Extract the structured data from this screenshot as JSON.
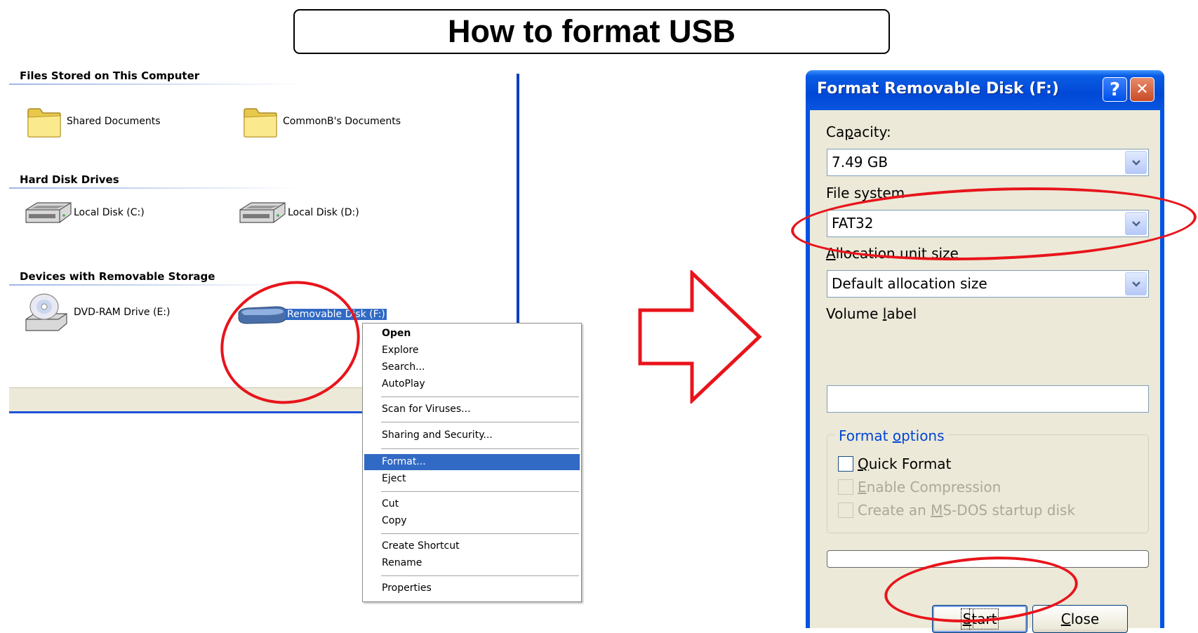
{
  "banner": {
    "title": "How to format USB"
  },
  "explorer": {
    "sections": [
      {
        "header": "Files Stored on This Computer"
      },
      {
        "header": "Hard Disk Drives"
      },
      {
        "header": "Devices with Removable Storage"
      }
    ],
    "items": [
      {
        "label": "Shared Documents",
        "icon": "folder-icon"
      },
      {
        "label": "CommonB's Documents",
        "icon": "folder-icon"
      },
      {
        "label": "Local Disk (C:)",
        "icon": "hard-disk-icon"
      },
      {
        "label": "Local Disk (D:)",
        "icon": "hard-disk-icon"
      },
      {
        "label": "DVD-RAM Drive (E:)",
        "icon": "dvd-drive-icon"
      },
      {
        "label": "Removable Disk (F:)",
        "icon": "removable-disk-icon",
        "selected": true
      }
    ]
  },
  "context_menu": {
    "items": [
      {
        "label": "Open",
        "default": true
      },
      {
        "label": "Explore"
      },
      {
        "label": "Search..."
      },
      {
        "label": "AutoPlay"
      },
      {
        "label": "Scan for Viruses..."
      },
      {
        "label": "Sharing and Security..."
      },
      {
        "label": "Format...",
        "highlighted": true
      },
      {
        "label": "Eject"
      },
      {
        "label": "Cut"
      },
      {
        "label": "Copy"
      },
      {
        "label": "Create Shortcut"
      },
      {
        "label": "Rename"
      },
      {
        "label": "Properties"
      }
    ]
  },
  "dialog": {
    "title": "Format Removable Disk (F:)",
    "help_glyph": "?",
    "close_glyph": "✕",
    "capacity": {
      "label_pre": "Ca",
      "label_u": "p",
      "label_post": "acity:",
      "value": "7.49 GB"
    },
    "file_system": {
      "label": "File system",
      "value": "FAT32"
    },
    "allocation": {
      "label_u": "A",
      "label_post": "llocation unit size",
      "value": "Default allocation size"
    },
    "volume": {
      "label_pre": "Volume ",
      "label_u": "l",
      "label_post": "abel",
      "value": ""
    },
    "format_options": {
      "legend_pre": "Format ",
      "legend_u": "o",
      "legend_post": "ptions",
      "quick_format": {
        "label_u": "Q",
        "label_post": "uick Format",
        "checked": false,
        "enabled": true
      },
      "enable_compression": {
        "label_u": "E",
        "label_post": "nable Compression",
        "checked": false,
        "enabled": false
      },
      "msdos_startup": {
        "label_pre": "Create an ",
        "label_u": "M",
        "label_post": "S-DOS startup disk",
        "checked": false,
        "enabled": false
      }
    },
    "progress": 0,
    "start_button": {
      "label_u": "S",
      "label_post": "tart"
    },
    "close_button": {
      "label_u": "C",
      "label_post": "lose"
    }
  },
  "colors": {
    "annotation_red": "#e8141b",
    "xp_blue": "#0054e3",
    "selection_blue": "#316ac5",
    "dialog_face": "#ece9d8"
  }
}
